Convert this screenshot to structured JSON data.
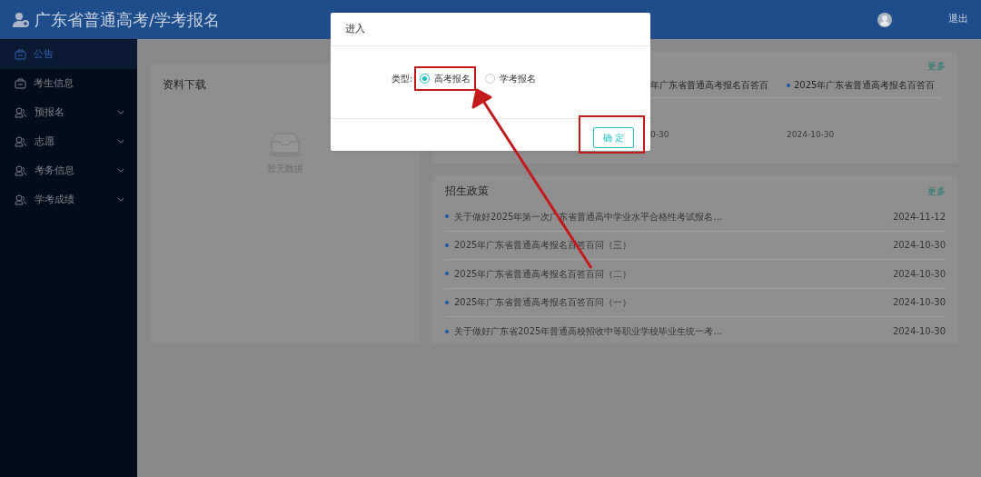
{
  "header": {
    "title": "广东省普通高考/学考报名",
    "logout": "退出"
  },
  "sidebar": {
    "items": [
      {
        "label": "公告",
        "kind": "plain",
        "selected": true
      },
      {
        "label": "考生信息",
        "kind": "plain",
        "selected": false
      },
      {
        "label": "预报名",
        "kind": "group",
        "selected": false
      },
      {
        "label": "志愿",
        "kind": "group",
        "selected": false
      },
      {
        "label": "考务信息",
        "kind": "group",
        "selected": false
      },
      {
        "label": "学考成绩",
        "kind": "group",
        "selected": false
      }
    ]
  },
  "downloads": {
    "title": "资料下载",
    "empty_text": "暂无数据"
  },
  "announcements": {
    "more": "更多",
    "items": [
      {
        "title": "年广东省普通高考报名百答百",
        "date": "0-30",
        "bullet": false
      },
      {
        "title": "2025年广东省普通高考报名百答百",
        "date": "2024-10-30",
        "bullet": true
      }
    ]
  },
  "policies": {
    "title": "招生政策",
    "more": "更多",
    "items": [
      {
        "title": "关于做好2025年第一次广东省普通高中学业水平合格性考试报名...",
        "date": "2024-11-12"
      },
      {
        "title": "2025年广东省普通高考报名百答百问（三）",
        "date": "2024-10-30"
      },
      {
        "title": "2025年广东省普通高考报名百答百问（二）",
        "date": "2024-10-30"
      },
      {
        "title": "2025年广东省普通高考报名百答百问（一）",
        "date": "2024-10-30"
      },
      {
        "title": "关于做好广东省2025年普通高校招收中等职业学校毕业生统一考...",
        "date": "2024-10-30"
      }
    ]
  },
  "dialog": {
    "title": "进入",
    "field_label": "类型:",
    "options": [
      {
        "label": "高考报名",
        "selected": true,
        "highlighted": true
      },
      {
        "label": "学考报名",
        "selected": false,
        "highlighted": false
      }
    ],
    "confirm": "确 定",
    "confirm_highlighted": true
  }
}
